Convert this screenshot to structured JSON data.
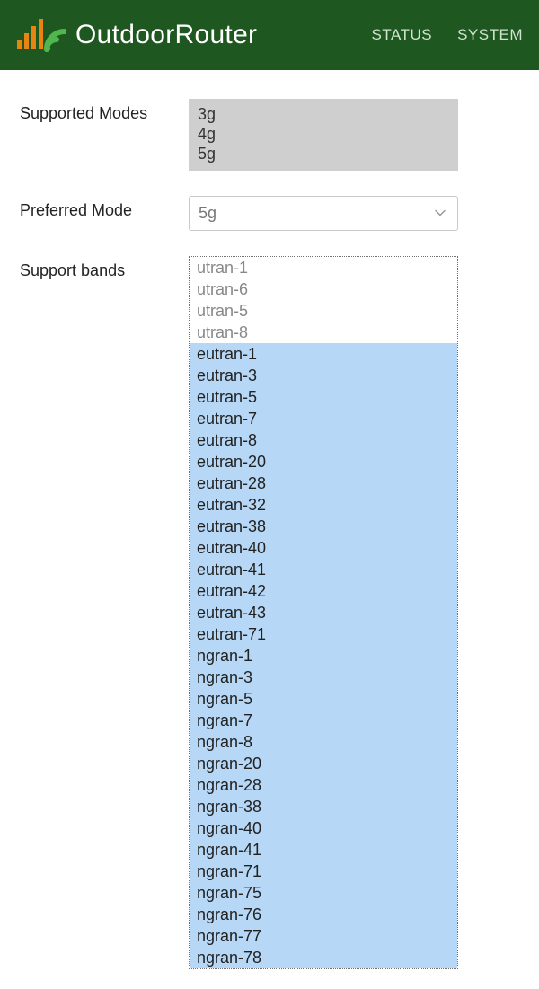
{
  "header": {
    "brand": "OutdoorRouter",
    "nav": {
      "status": "STATUS",
      "system": "SYSTEM"
    }
  },
  "form": {
    "supported_modes_label": "Supported Modes",
    "supported_modes": [
      "3g",
      "4g",
      "5g"
    ],
    "preferred_mode_label": "Preferred Mode",
    "preferred_mode_value": "5g",
    "support_bands_label": "Support bands",
    "bands": [
      {
        "name": "utran-1",
        "selected": false
      },
      {
        "name": "utran-6",
        "selected": false
      },
      {
        "name": "utran-5",
        "selected": false
      },
      {
        "name": "utran-8",
        "selected": false
      },
      {
        "name": "eutran-1",
        "selected": true
      },
      {
        "name": "eutran-3",
        "selected": true
      },
      {
        "name": "eutran-5",
        "selected": true
      },
      {
        "name": "eutran-7",
        "selected": true
      },
      {
        "name": "eutran-8",
        "selected": true
      },
      {
        "name": "eutran-20",
        "selected": true
      },
      {
        "name": "eutran-28",
        "selected": true
      },
      {
        "name": "eutran-32",
        "selected": true
      },
      {
        "name": "eutran-38",
        "selected": true
      },
      {
        "name": "eutran-40",
        "selected": true
      },
      {
        "name": "eutran-41",
        "selected": true
      },
      {
        "name": "eutran-42",
        "selected": true
      },
      {
        "name": "eutran-43",
        "selected": true
      },
      {
        "name": "eutran-71",
        "selected": true
      },
      {
        "name": "ngran-1",
        "selected": true
      },
      {
        "name": "ngran-3",
        "selected": true
      },
      {
        "name": "ngran-5",
        "selected": true
      },
      {
        "name": "ngran-7",
        "selected": true
      },
      {
        "name": "ngran-8",
        "selected": true
      },
      {
        "name": "ngran-20",
        "selected": true
      },
      {
        "name": "ngran-28",
        "selected": true
      },
      {
        "name": "ngran-38",
        "selected": true
      },
      {
        "name": "ngran-40",
        "selected": true
      },
      {
        "name": "ngran-41",
        "selected": true
      },
      {
        "name": "ngran-71",
        "selected": true
      },
      {
        "name": "ngran-75",
        "selected": true
      },
      {
        "name": "ngran-76",
        "selected": true
      },
      {
        "name": "ngran-77",
        "selected": true
      },
      {
        "name": "ngran-78",
        "selected": true
      }
    ]
  }
}
